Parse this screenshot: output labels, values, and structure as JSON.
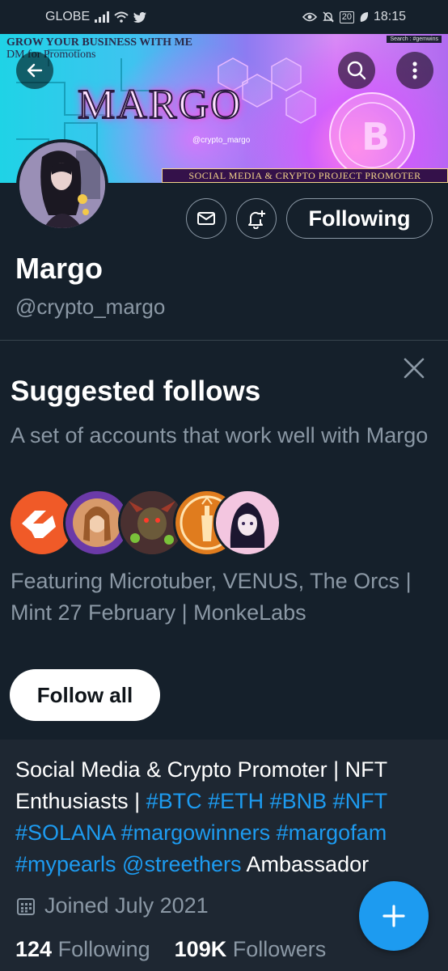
{
  "status_bar": {
    "carrier": "GLOBE",
    "battery": "20",
    "time": "18:15"
  },
  "banner": {
    "promo_line1": "GROW YOUR BUSINESS WITH ME",
    "promo_line2": "DM for Promotions",
    "search_tag": "Search : #gemwins",
    "logo_text": "MARGO",
    "handle_tag": "@crypto_margo",
    "ribbon": "SOCIAL MEDIA & CRYPTO PROJECT PROMOTER"
  },
  "profile": {
    "following_button": "Following",
    "display_name": "Margo",
    "handle": "@crypto_margo"
  },
  "suggested": {
    "title": "Suggested follows",
    "description": "A set of accounts that work well with Margo",
    "featuring": "Featuring Microtuber, VENUS, The Orcs | Mint 27 February | MonkeLabs",
    "follow_all": "Follow all",
    "face_colors": [
      "#f05a28",
      "#6b3aa8",
      "#5a3a2a",
      "#e07c1e",
      "#f3c6e0"
    ]
  },
  "bio": {
    "text1": "Social Media & Crypto Promoter | NFT Enthusiasts | ",
    "tags1": "#BTC #ETH #BNB #NFT #SOLANA #margowinners #margofam #mypearls @streethers",
    "text2": " Ambassador",
    "joined": "Joined July 2021",
    "following_count": "124",
    "following_label": "Following",
    "followers_count": "109K",
    "followers_label": "Followers"
  },
  "icons": {
    "back": "arrow-left-icon",
    "search": "search-icon",
    "more": "more-vertical-icon",
    "message": "mail-icon",
    "notify": "bell-plus-icon",
    "close": "close-icon",
    "calendar": "calendar-icon",
    "compose": "plus-icon"
  },
  "colors": {
    "background": "#15202b",
    "accent": "#1d9bf0",
    "secondary_text": "#8b98a5"
  }
}
